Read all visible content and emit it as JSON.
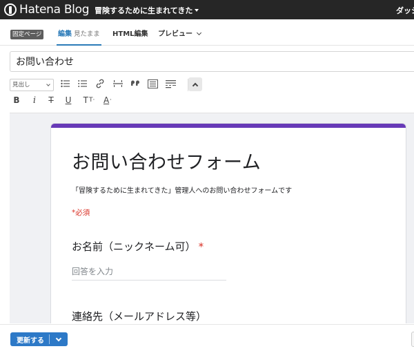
{
  "header": {
    "logo_text": "Hatena Blog",
    "blog_title": "冒険するために生まれてきた",
    "right_link": "ダッシ"
  },
  "tabs": {
    "page_badge": "固定ページ",
    "edit": "編集",
    "edit_mode": "見たまま",
    "html": "HTML編集",
    "preview": "プレビュー"
  },
  "title_input": {
    "value": "お問い合わせ"
  },
  "toolbar": {
    "heading_select": "見出し",
    "heading_select_arrow": "chevron-down-icon",
    "row1_icons": [
      "bulleted-list-icon",
      "numbered-list-icon",
      "link-icon",
      "horizontal-rule-icon",
      "blockquote-icon",
      "table-of-contents-icon",
      "read-more-icon",
      "collapse-toolbar-icon"
    ],
    "bold": "B",
    "italic": "i",
    "strike": "T",
    "underline": "U",
    "font_size": "T",
    "font_color": "A"
  },
  "form": {
    "accent_color": "#673ab7",
    "title": "お問い合わせフォーム",
    "description": "「冒険するために生まれてきた」管理人へのお問い合わせフォームです",
    "required_note": "*必須",
    "q1_label": "お名前（ニックネーム可）",
    "q1_required": "*",
    "q1_placeholder": "回答を入力",
    "q2_label": "連絡先（メールアドレス等）"
  },
  "footer": {
    "update_label": "更新する",
    "update_color": "#2d79c7"
  }
}
